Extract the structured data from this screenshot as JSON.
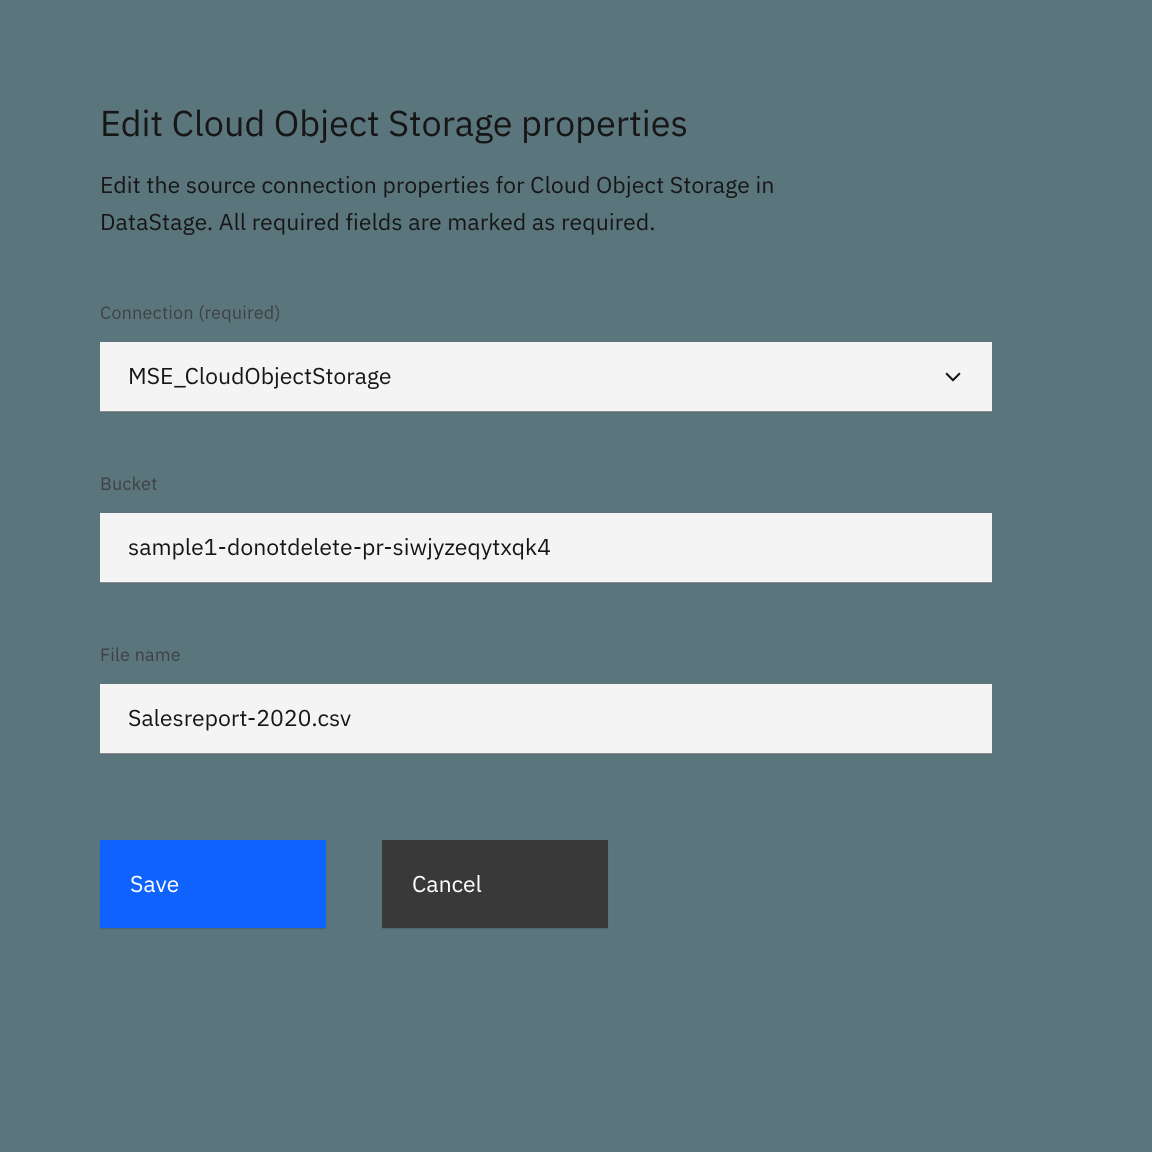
{
  "header": {
    "title": "Edit Cloud Object Storage properties",
    "subtitle": "Edit the source connection properties for Cloud Object Storage in DataStage. All required fields are marked as required."
  },
  "fields": {
    "connection": {
      "label": "Connection (required)",
      "value": "MSE_CloudObjectStorage"
    },
    "bucket": {
      "label": "Bucket",
      "value": "sample1-donotdelete-pr-siwjyzeqytxqk4"
    },
    "filename": {
      "label": "File name",
      "value": "Salesreport-2020.csv"
    }
  },
  "actions": {
    "save": "Save",
    "cancel": "Cancel"
  },
  "colors": {
    "primary": "#0f62fe",
    "secondary": "#393939",
    "field_bg": "#f4f4f4",
    "page_bg": "#5b757d"
  }
}
